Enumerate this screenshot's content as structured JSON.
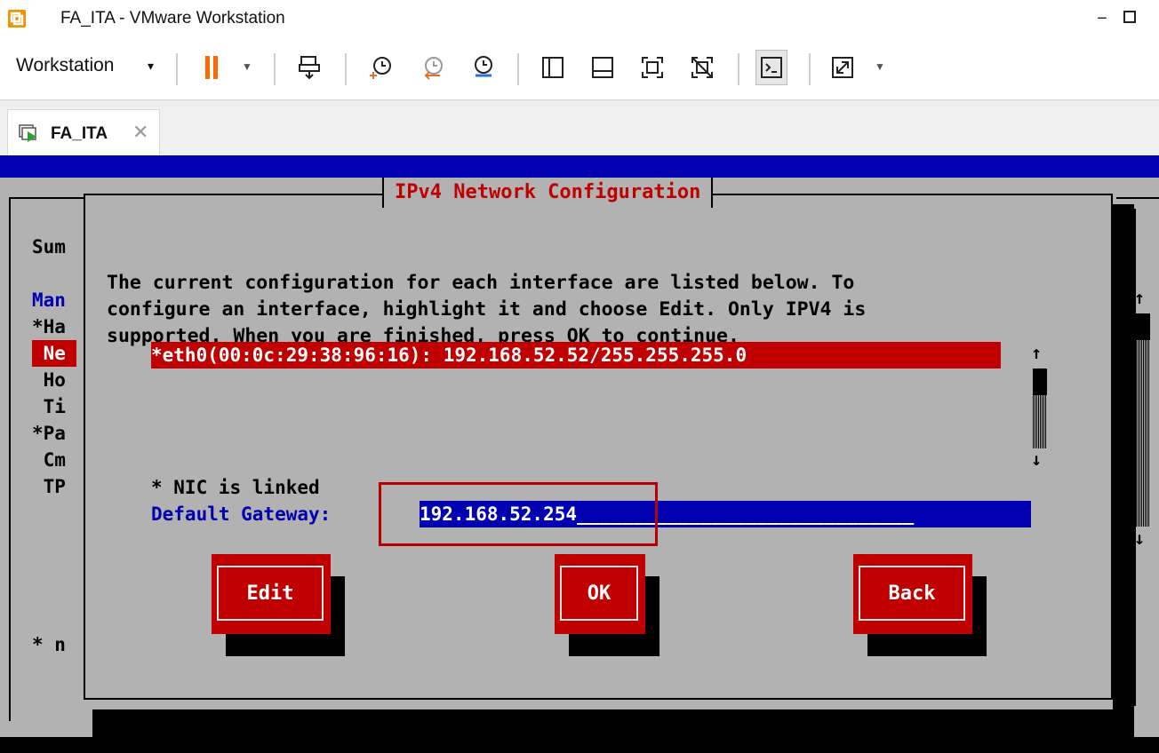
{
  "window": {
    "title": "FA_ITA - VMware Workstation",
    "minimize": "−"
  },
  "toolbar": {
    "workstation_label": "Workstation",
    "workstation_caret": "▾",
    "icons": [
      "pause-icon",
      "send-ctrl-alt-del-icon",
      "snapshot-take-icon",
      "snapshot-revert-icon",
      "snapshot-manager-icon",
      "show-library-icon",
      "show-thumbnail-bar-icon",
      "full-screen-icon",
      "unity-icon",
      "console-view-icon",
      "stretch-guest-icon"
    ]
  },
  "tab": {
    "label": "FA_ITA",
    "close": "✕"
  },
  "console": {
    "background_left_lines": [
      "Sum",
      "",
      "Man",
      "*Ha",
      " Ne",
      " Ho",
      " Ti",
      "*Pa",
      " Cm",
      " TP"
    ],
    "background_footer": "* n",
    "dialog": {
      "title": "IPv4 Network Configuration",
      "instructions": [
        "The current configuration for each interface are listed below. To",
        "configure an interface, highlight it and choose Edit. Only IPV4 is",
        "supported. When you are finished, press OK to continue."
      ],
      "interfaces": [
        "*eth0(00:0c:29:38:96:16): 192.168.52.52/255.255.255.0"
      ],
      "scroll_up": "↑",
      "scroll_down": "↓",
      "nic_status": "* NIC is linked",
      "gateway_label": "Default Gateway:",
      "gateway_value": "192.168.52.254______________________________",
      "buttons": {
        "edit": "Edit",
        "ok": "OK",
        "back": "Back"
      }
    }
  },
  "colors": {
    "tui_red": "#c00000",
    "tui_blue": "#0000b0",
    "tui_gray": "#b2b2b2",
    "vmware_pause_orange": "#ff6a00"
  }
}
